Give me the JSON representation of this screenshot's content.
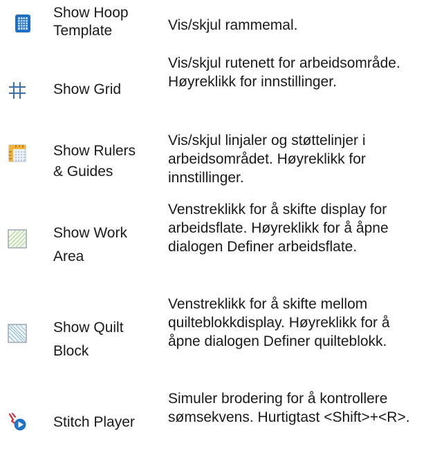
{
  "rows": [
    {
      "icon": "hoop-template-icon",
      "name_lines": [
        "Show Hoop",
        "Template"
      ],
      "description": "Vis/skjul rammemal."
    },
    {
      "icon": "grid-icon",
      "name_lines": [
        "Show Grid"
      ],
      "description": "Vis/skjul rutenett for arbeidsområde. Høyreklikk for innstillinger."
    },
    {
      "icon": "rulers-guides-icon",
      "name_lines": [
        "Show Rulers",
        "& Guides"
      ],
      "description": "Vis/skjul linjaler og støttelinjer i arbeidsområdet. Høyreklikk for innstillinger."
    },
    {
      "icon": "work-area-icon",
      "name_lines": [
        "Show Work",
        "Area"
      ],
      "description": "Venstreklikk for å skifte display for arbeidsflate. Høyreklikk for å åpne dialogen Definer arbeidsflate."
    },
    {
      "icon": "quilt-block-icon",
      "name_lines": [
        "Show Quilt",
        "Block"
      ],
      "description": "Venstreklikk for å skifte mellom quilteblokkdisplay. Høyreklikk for å åpne dialogen Definer quilteblokk."
    },
    {
      "icon": "stitch-player-icon",
      "name_lines": [
        "Stitch Player"
      ],
      "description": "Simuler brodering for å kontrollere sømsekvens. Hurtigtast <Shift>+<R>."
    }
  ]
}
